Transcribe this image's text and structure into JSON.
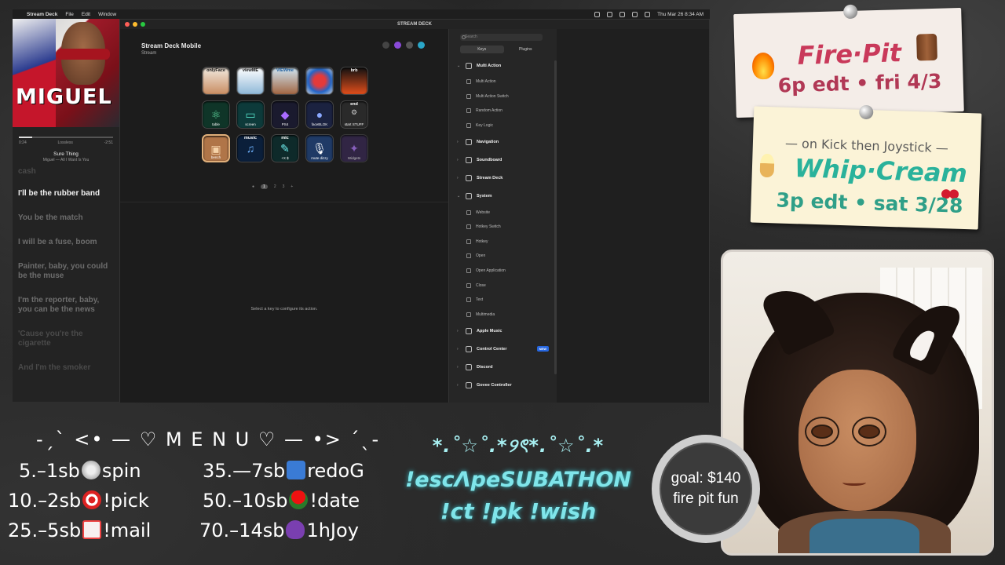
{
  "menubar": {
    "app": "Stream Deck",
    "items": [
      "File",
      "Edit",
      "Window"
    ],
    "clock": "Thu Mar 26  8:34 AM"
  },
  "music": {
    "album_text": "MIGUEL",
    "elapsed": "0:24",
    "format": "Lossless",
    "remaining": "-2:51",
    "track": "Sure Thing",
    "artist": "Miguel — All I Want Is You",
    "lyrics": [
      "cash",
      "I'll be the rubber band",
      "You be the match",
      "I will be a fuse, boom",
      "Painter, baby, you could be the muse",
      "I'm the reporter, baby, you can be the news",
      "'Cause you're the cigarette",
      "And I'm the smoker"
    ]
  },
  "window": {
    "title": "STREAM DECK",
    "device": "Stream Deck Mobile",
    "profile": "Stream",
    "keys": [
      {
        "label": "onlyFace",
        "sub": ""
      },
      {
        "label": "viewME",
        "sub": ""
      },
      {
        "label": "VIEWme",
        "sub": ""
      },
      {
        "label": "",
        "sub": ""
      },
      {
        "label": "brb",
        "sub": ""
      },
      {
        "label": "",
        "sub": "table"
      },
      {
        "label": "",
        "sub": "screen"
      },
      {
        "label": "",
        "sub": "PS4"
      },
      {
        "label": "",
        "sub": "faceBLOK"
      },
      {
        "label": "end",
        "sub": "start STUFF"
      },
      {
        "label": "",
        "sub": "bench"
      },
      {
        "label": "music",
        "sub": ""
      },
      {
        "label": "mic",
        "sub": "+X $"
      },
      {
        "label": "",
        "sub": "mute dizzy"
      },
      {
        "label": "",
        "sub": "Widgets"
      }
    ],
    "pages": [
      "1",
      "2",
      "3"
    ],
    "hint": "Select a key to configure its action."
  },
  "actions": {
    "search_placeholder": "Search",
    "tabs": [
      "Keys",
      "Plugins"
    ],
    "multi_action": {
      "label": "Multi Action",
      "items": [
        "Multi Action",
        "Multi Action Switch",
        "Random Action",
        "Key Logic"
      ]
    },
    "categories_a": [
      "Navigation",
      "Soundboard",
      "Stream Deck"
    ],
    "system": {
      "label": "System",
      "items": [
        "Website",
        "Hotkey Switch",
        "Hotkey",
        "Open",
        "Open Application",
        "Close",
        "Text",
        "Multimedia"
      ]
    },
    "categories_b": [
      "Apple Music",
      "Control Center",
      "Discord",
      "Govee Controller"
    ],
    "new_badge": "NEW"
  },
  "schedule": {
    "card1_title": "Fire·Pit",
    "card1_date": "6p edt • fri 4/3",
    "card2_line": "— on Kick then Joystick —",
    "card2_title": "Whip·Cream",
    "card2_date": "3p edt • sat 3/28"
  },
  "goal": {
    "line1": "goal: $140",
    "line2": "fire pit fun"
  },
  "menu": {
    "title": "-ˏˋ <• — ♡ M E N U ♡ — •> ˊˎ-",
    "left": [
      {
        "amt": "5.–1sb",
        "label": "spin"
      },
      {
        "amt": "10.–2sb",
        "label": "!pick"
      },
      {
        "amt": "25.–5sb",
        "label": "!mail"
      }
    ],
    "right": [
      {
        "amt": "35.—7sb",
        "label": "redoG"
      },
      {
        "amt": "50.–10sb",
        "label": "!date"
      },
      {
        "amt": "70.–14sb",
        "label": "1hJoy"
      }
    ]
  },
  "commands": {
    "stars": "*.˚☆˚.*୨ৎ*.˚☆˚.*",
    "subathon": "!escΛpeSUBATHON",
    "cmds": "!ct !pk !wish"
  }
}
